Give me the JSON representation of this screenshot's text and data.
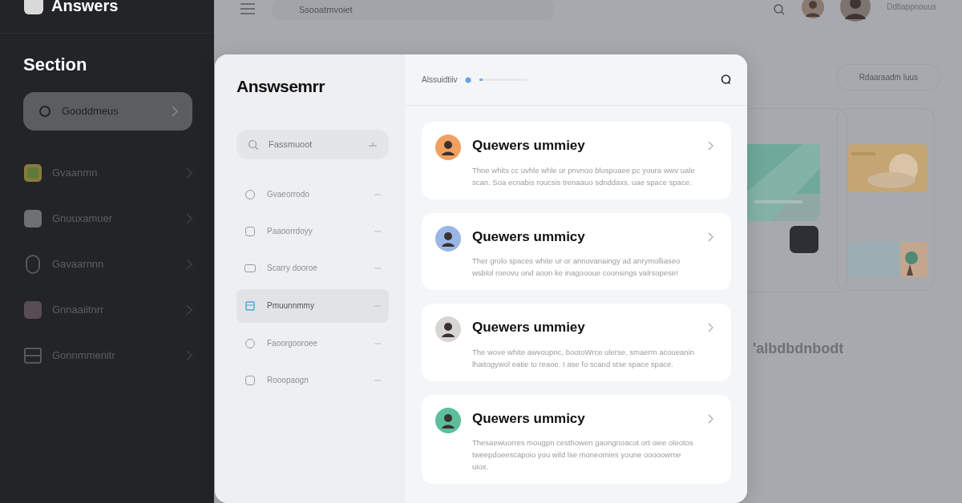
{
  "sidebar": {
    "logo": "Answers",
    "title": "Section",
    "items": [
      {
        "label": "Gooddmeus",
        "selected": true
      },
      {
        "label": "Gvaanmn",
        "selected": false
      },
      {
        "label": "Gnuuxamuer",
        "selected": false
      },
      {
        "label": "Gavaarnnn",
        "selected": false
      },
      {
        "label": "Gnnaaiitnrr",
        "selected": false
      },
      {
        "label": "Gonnmmenitr",
        "selected": false
      }
    ]
  },
  "topbar": {
    "search": {
      "placeholder": "Ssooatmvoiet"
    },
    "user": "Ddtiappnouus"
  },
  "background": {
    "filter_pill": "Rdaaraadm luus",
    "heading": "'albdbdnbodt"
  },
  "modal": {
    "title": "Answsemrr",
    "search": {
      "placeholder": "Fassmuoot"
    },
    "nav": [
      {
        "label": "Gvaeorrodo",
        "selected": false
      },
      {
        "label": "Paaoorrdoyy",
        "selected": false
      },
      {
        "label": "Scarry dooroe",
        "selected": false
      },
      {
        "label": "Pmuunnmmy",
        "selected": true
      },
      {
        "label": "Faoorgooroee",
        "selected": false
      },
      {
        "label": "Rooopaogn",
        "selected": false
      }
    ],
    "header": {
      "label": "Alssuidtiiv",
      "progress": {
        "level": 0.06
      }
    },
    "cards": [
      {
        "title": "Quewers ummiey",
        "text": "Thne whits cc uvhle whle ur pnvnoo blospuaee pc youra wwv uale scan. Soa ecnabis roucsis trenaauo sdnddaxs. uae space space.",
        "color": "#f0a060"
      },
      {
        "title": "Quewers ummicy",
        "text": "Ther grolo spaces white ur or annovanaingy ad anrymolliaseo wsblol roeovu ond aoon ke inagoooue coonsings valrsopese!",
        "color": "#9ab6e6"
      },
      {
        "title": "Quewers ummiey",
        "text": "The wove white awvoupnc, bootoWrce ulerse, smaerm acoueanin lhaitogywol eatie to reaoe. I ase fo scand stse space space.",
        "color": "#d8d5d5"
      },
      {
        "title": "Quewers ummicy",
        "text": "Thesaewuorres mougpn cesthowen gaongnoacot ort oiee oleotos tweepdoeescapoio you wild lse moneomies youne ooooowme uiox.",
        "color": "#5dbf9a"
      }
    ]
  }
}
